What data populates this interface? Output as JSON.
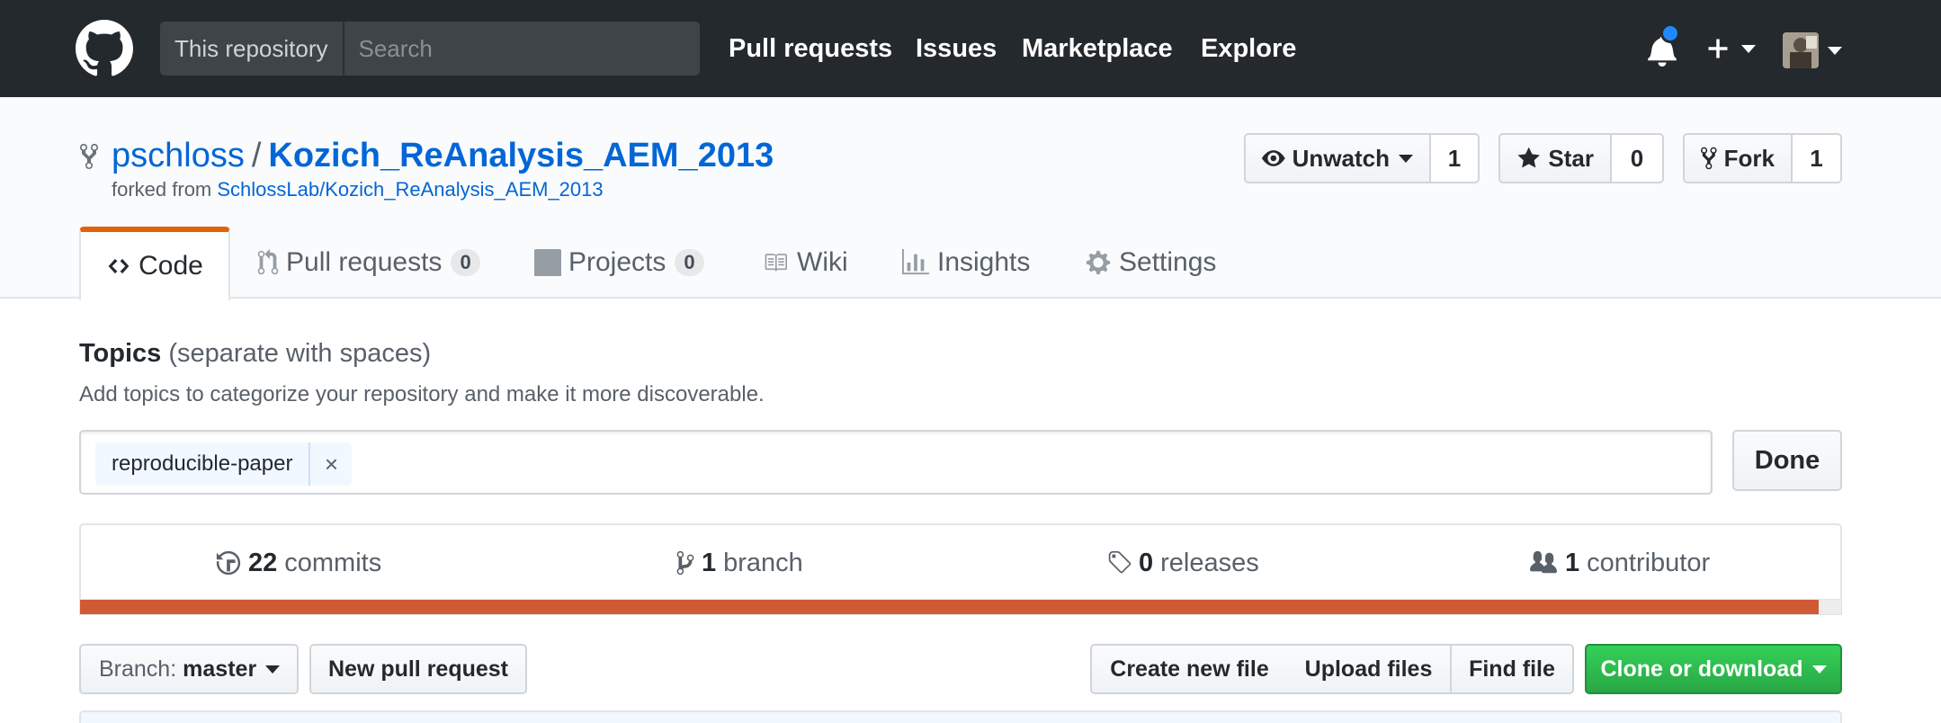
{
  "header": {
    "search_scope": "This repository",
    "search_placeholder": "Search",
    "nav": [
      "Pull requests",
      "Issues",
      "Marketplace",
      "Explore"
    ],
    "icons": [
      "github-logo-icon",
      "bell-icon",
      "plus-icon",
      "avatar"
    ]
  },
  "repo": {
    "owner": "pschloss",
    "separator": "/",
    "name": "Kozich_ReAnalysis_AEM_2013",
    "forked_prefix": "forked from ",
    "forked_source": "SchlossLab/Kozich_ReAnalysis_AEM_2013"
  },
  "actions": {
    "watch_label": "Unwatch",
    "watch_count": "1",
    "star_label": "Star",
    "star_count": "0",
    "fork_label": "Fork",
    "fork_count": "1"
  },
  "tabs": {
    "code": "Code",
    "pulls": "Pull requests",
    "pulls_count": "0",
    "projects": "Projects",
    "projects_count": "0",
    "wiki": "Wiki",
    "insights": "Insights",
    "settings": "Settings"
  },
  "topics": {
    "heading": "Topics",
    "hint": "(separate with spaces)",
    "description": "Add topics to categorize your repository and make it more discoverable.",
    "tags": [
      "reproducible-paper"
    ],
    "remove_glyph": "×",
    "done_label": "Done"
  },
  "summary": {
    "commits_count": "22",
    "commits_label": "commits",
    "branches_count": "1",
    "branches_label": "branch",
    "releases_count": "0",
    "releases_label": "releases",
    "contributors_count": "1",
    "contributors_label": "contributor",
    "language_bar_fraction": 0.987,
    "language_color": "#d15a36"
  },
  "file_nav": {
    "branch_prefix": "Branch:",
    "branch_name": "master",
    "new_pr": "New pull request",
    "create_file": "Create new file",
    "upload_files": "Upload files",
    "find_file": "Find file",
    "clone": "Clone or download"
  },
  "colors": {
    "header_bg": "#24292e",
    "link": "#0366d6",
    "tab_accent": "#e36209",
    "primary_green": "#28a745",
    "notification_dot": "#2188ff"
  }
}
